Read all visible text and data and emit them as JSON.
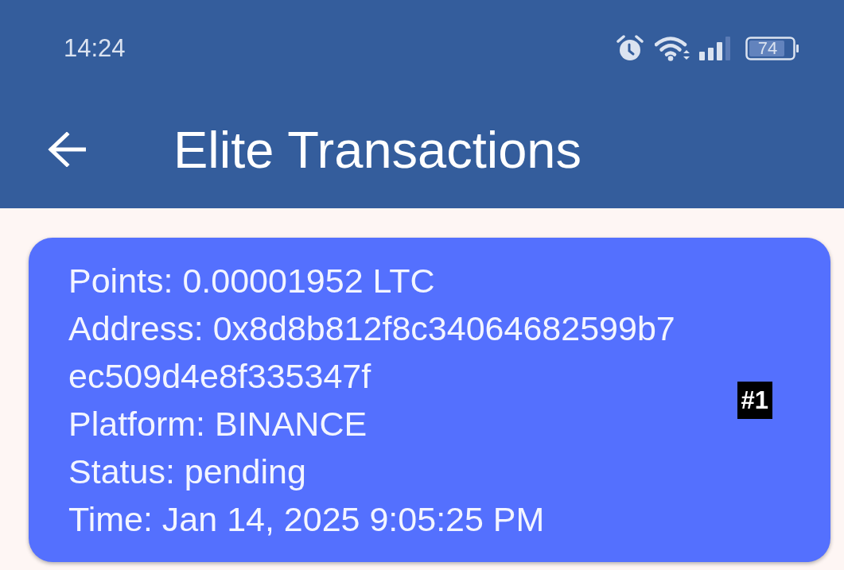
{
  "status_bar": {
    "time": "14:24",
    "battery": "74"
  },
  "app_bar": {
    "title": "Elite Transactions"
  },
  "transactions": [
    {
      "points": "Points: 0.00001952 LTC",
      "address": "Address: 0x8d8b812f8c34064682599b7ec509d4e8f335347f",
      "platform": "Platform: BINANCE",
      "status": "Status: pending",
      "time": "Time: Jan 14, 2025 9:05:25 PM",
      "badge": "#1"
    }
  ]
}
